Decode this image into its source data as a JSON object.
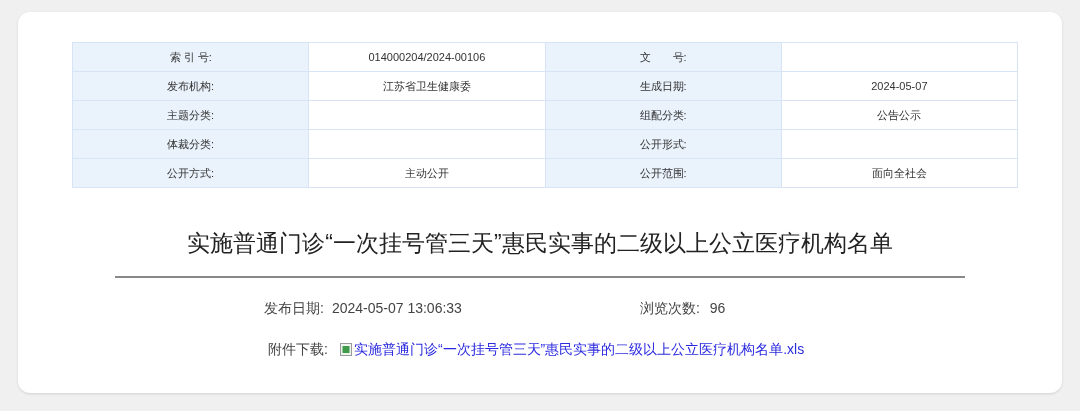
{
  "info_table": {
    "rows": [
      {
        "cells": [
          {
            "label": "索 引 号:",
            "value": "014000204/2024-00106"
          },
          {
            "label": "文　　号:"
          }
        ]
      },
      {
        "cells": [
          {
            "label": "发布机构:",
            "value": "江苏省卫生健康委"
          },
          {
            "label": "生成日期:",
            "value": "2024-05-07"
          }
        ]
      },
      {
        "cells": [
          {
            "label": "主题分类:"
          },
          {
            "label": "组配分类:",
            "value": "公告公示"
          }
        ]
      },
      {
        "cells": [
          {
            "label": "体裁分类:"
          },
          {
            "label": "公开形式:"
          }
        ]
      },
      {
        "cells": [
          {
            "label": "公开方式:",
            "value": "主动公开"
          },
          {
            "label": "公开范围:",
            "value": "面向全社会"
          }
        ]
      }
    ]
  },
  "title": "实施普通门诊“一次挂号管三天”惠民实事的二级以上公立医疗机构名单",
  "meta": {
    "publish_label": "发布日期:",
    "publish_value": "2024-05-07 13:06:33",
    "views_label": "浏览次数:",
    "views_value": "96"
  },
  "attachment": {
    "label": "附件下载:",
    "file": "实施普通门诊“一次挂号管三天”惠民实事的二级以上公立医疗机构名单.xls"
  }
}
